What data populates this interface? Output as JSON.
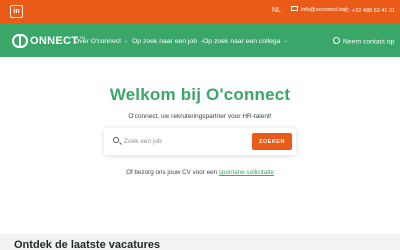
{
  "topbar": {
    "social_label": "in",
    "language": "NL",
    "email": "info@oconnect.be",
    "phone": "+32 488 53 41 31"
  },
  "nav": {
    "logo_text": "ONNECT",
    "logo_tm": "TM",
    "items": [
      {
        "label": "Over O'connect"
      },
      {
        "label": "Op zoek naar een job"
      },
      {
        "label": "Op zoek naar een collega"
      }
    ],
    "contact": "Neem contact op"
  },
  "hero": {
    "title": "Welkom bij O'connect",
    "subtitle": "O'connect,  uw rekruteringspartner voor HR-talent!",
    "search": {
      "placeholder": "Zoek een job",
      "button": "ZOEKEN"
    },
    "cv_text": "Of bezorg ons jouw CV voor een ",
    "cv_link": "spontane sollicitatie"
  },
  "section": {
    "title": "Ontdek de laatste vacatures"
  },
  "colors": {
    "orange": "#ea5b17",
    "green": "#3aa66a"
  }
}
